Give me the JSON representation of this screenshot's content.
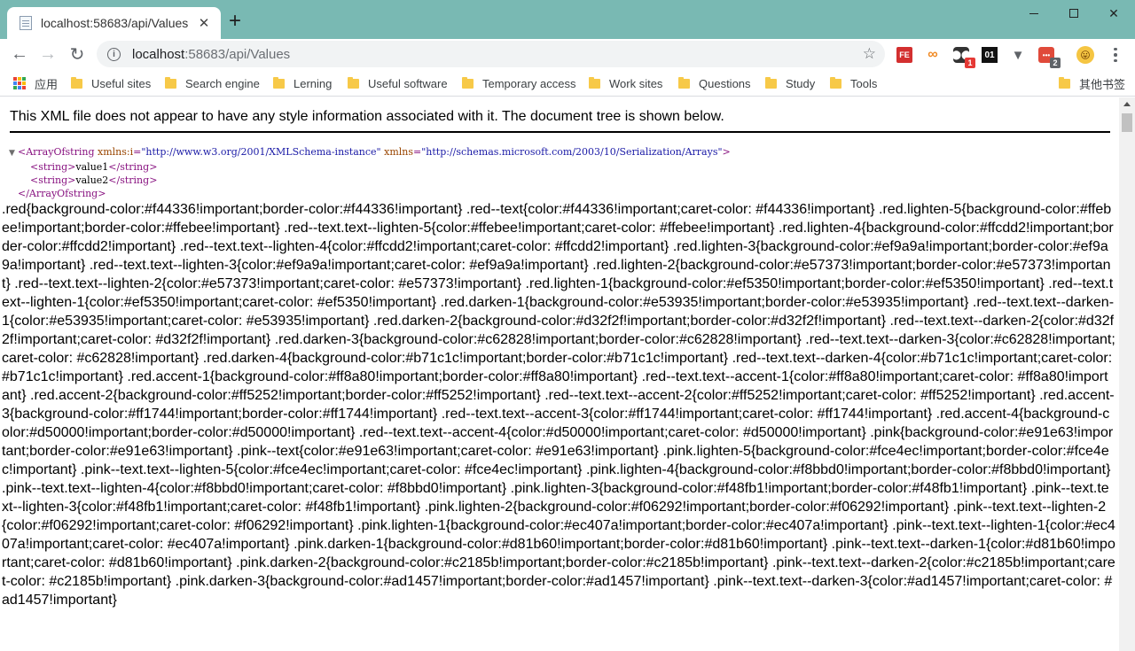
{
  "tab": {
    "title": "localhost:58683/api/Values",
    "close": "✕",
    "new_tab": "+"
  },
  "window": {
    "minimize": "minimize",
    "maximize": "maximize",
    "close": "✕"
  },
  "toolbar": {
    "back": "←",
    "forward": "→",
    "reload": "↻",
    "url_host": "localhost",
    "url_rest": ":58683/api/Values",
    "info_icon": "i",
    "star": "☆"
  },
  "extensions": {
    "fe_label": "FE",
    "infinity_label": "∞",
    "tm_badge": "1",
    "zero_one_label": "01",
    "v_label": "▼",
    "msg_badge": "2",
    "emoji_label": "😛"
  },
  "bookmarks": {
    "apps_label": "应用",
    "items": [
      "Useful sites",
      "Search engine",
      "Lerning",
      "Useful software",
      "Temporary access",
      "Work sites",
      "Questions",
      "Study",
      "Tools"
    ],
    "other": "其他书签"
  },
  "content": {
    "notice": "This XML file does not appear to have any style information associated with it. The document tree is shown below.",
    "xml": {
      "root_open": "<ArrayOfstring",
      "attr1_name": "xmlns:i",
      "attr1_value": "\"http://www.w3.org/2001/XMLSchema-instance\"",
      "attr2_name": "xmlns",
      "attr2_value": "\"http://schemas.microsoft.com/2003/10/Serialization/Arrays\"",
      "root_close_bracket": ">",
      "string_open": "<string>",
      "string_close": "</string>",
      "value1": "value1",
      "value2": "value2",
      "root_close": "</ArrayOfstring>"
    },
    "css_text": ".red{background-color:#f44336!important;border-color:#f44336!important} .red--text{color:#f44336!important;caret-color: #f44336!important} .red.lighten-5{background-color:#ffebee!important;border-color:#ffebee!important} .red--text.text--lighten-5{color:#ffebee!important;caret-color: #ffebee!important} .red.lighten-4{background-color:#ffcdd2!important;border-color:#ffcdd2!important} .red--text.text--lighten-4{color:#ffcdd2!important;caret-color: #ffcdd2!important} .red.lighten-3{background-color:#ef9a9a!important;border-color:#ef9a9a!important} .red--text.text--lighten-3{color:#ef9a9a!important;caret-color: #ef9a9a!important} .red.lighten-2{background-color:#e57373!important;border-color:#e57373!important} .red--text.text--lighten-2{color:#e57373!important;caret-color: #e57373!important} .red.lighten-1{background-color:#ef5350!important;border-color:#ef5350!important} .red--text.text--lighten-1{color:#ef5350!important;caret-color: #ef5350!important} .red.darken-1{background-color:#e53935!important;border-color:#e53935!important} .red--text.text--darken-1{color:#e53935!important;caret-color: #e53935!important} .red.darken-2{background-color:#d32f2f!important;border-color:#d32f2f!important} .red--text.text--darken-2{color:#d32f2f!important;caret-color: #d32f2f!important} .red.darken-3{background-color:#c62828!important;border-color:#c62828!important} .red--text.text--darken-3{color:#c62828!important;caret-color: #c62828!important} .red.darken-4{background-color:#b71c1c!important;border-color:#b71c1c!important} .red--text.text--darken-4{color:#b71c1c!important;caret-color: #b71c1c!important} .red.accent-1{background-color:#ff8a80!important;border-color:#ff8a80!important} .red--text.text--accent-1{color:#ff8a80!important;caret-color: #ff8a80!important} .red.accent-2{background-color:#ff5252!important;border-color:#ff5252!important} .red--text.text--accent-2{color:#ff5252!important;caret-color: #ff5252!important} .red.accent-3{background-color:#ff1744!important;border-color:#ff1744!important} .red--text.text--accent-3{color:#ff1744!important;caret-color: #ff1744!important} .red.accent-4{background-color:#d50000!important;border-color:#d50000!important} .red--text.text--accent-4{color:#d50000!important;caret-color: #d50000!important} .pink{background-color:#e91e63!important;border-color:#e91e63!important} .pink--text{color:#e91e63!important;caret-color: #e91e63!important} .pink.lighten-5{background-color:#fce4ec!important;border-color:#fce4ec!important} .pink--text.text--lighten-5{color:#fce4ec!important;caret-color: #fce4ec!important} .pink.lighten-4{background-color:#f8bbd0!important;border-color:#f8bbd0!important} .pink--text.text--lighten-4{color:#f8bbd0!important;caret-color: #f8bbd0!important} .pink.lighten-3{background-color:#f48fb1!important;border-color:#f48fb1!important} .pink--text.text--lighten-3{color:#f48fb1!important;caret-color: #f48fb1!important} .pink.lighten-2{background-color:#f06292!important;border-color:#f06292!important} .pink--text.text--lighten-2{color:#f06292!important;caret-color: #f06292!important} .pink.lighten-1{background-color:#ec407a!important;border-color:#ec407a!important} .pink--text.text--lighten-1{color:#ec407a!important;caret-color: #ec407a!important} .pink.darken-1{background-color:#d81b60!important;border-color:#d81b60!important} .pink--text.text--darken-1{color:#d81b60!important;caret-color: #d81b60!important} .pink.darken-2{background-color:#c2185b!important;border-color:#c2185b!important} .pink--text.text--darken-2{color:#c2185b!important;caret-color: #c2185b!important} .pink.darken-3{background-color:#ad1457!important;border-color:#ad1457!important} .pink--text.text--darken-3{color:#ad1457!important;caret-color: #ad1457!important}"
  },
  "colors": {
    "titlebar": "#79b9b3",
    "xml_tag": "#881280",
    "xml_attr": "#994500",
    "xml_value": "#1a1aa6"
  }
}
